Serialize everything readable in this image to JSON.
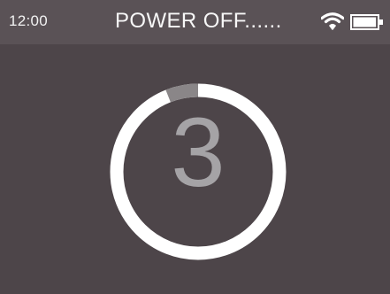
{
  "status_bar": {
    "time": "12:00",
    "title": "POWER OFF......",
    "wifi_icon": "wifi-icon",
    "battery_icon": "battery-icon",
    "battery_level": 0.95
  },
  "countdown": {
    "value": "3",
    "progress_fraction": 0.06
  },
  "colors": {
    "background": "#4d4549",
    "status_bar": "#5a5256",
    "ring": "#ffffff",
    "ring_progress": "#8a8688",
    "number": "#a5a3a6"
  }
}
